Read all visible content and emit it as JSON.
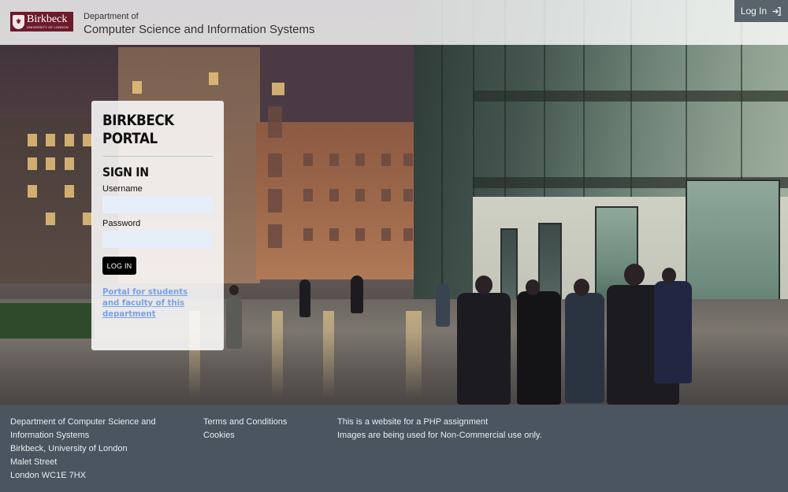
{
  "header": {
    "logo_name": "Birkbeck",
    "logo_sub": "UNIVERSITY OF LONDON",
    "dept_small": "Department of",
    "dept_big": "Computer Science and Information Systems",
    "login_label": "Log In",
    "login_icon": "sign-in-icon"
  },
  "card": {
    "title_line1": "BIRKBECK",
    "title_line2": "PORTAL",
    "signin_heading": "SIGN IN",
    "username_label": "Username",
    "username_value": "",
    "password_label": "Password",
    "password_value": "",
    "login_button": "LOG IN",
    "portal_link": "Portal for students and faculty of this department"
  },
  "footer": {
    "address": [
      "Department of Computer Science and",
      "Information Systems",
      "Birkbeck, University of London",
      "Malet Street",
      "London WC1E 7HX"
    ],
    "links": [
      "Terms and Conditions",
      "Cookies"
    ],
    "notes": [
      "This is a website for a PHP assignment",
      "Images are being used for Non-Commercial use only."
    ]
  },
  "colors": {
    "brand": "#6d1a2c",
    "footer_bg": "#4a555f",
    "link": "#7aa2e8",
    "button": "#000000",
    "input_bg": "#e6eefa"
  }
}
